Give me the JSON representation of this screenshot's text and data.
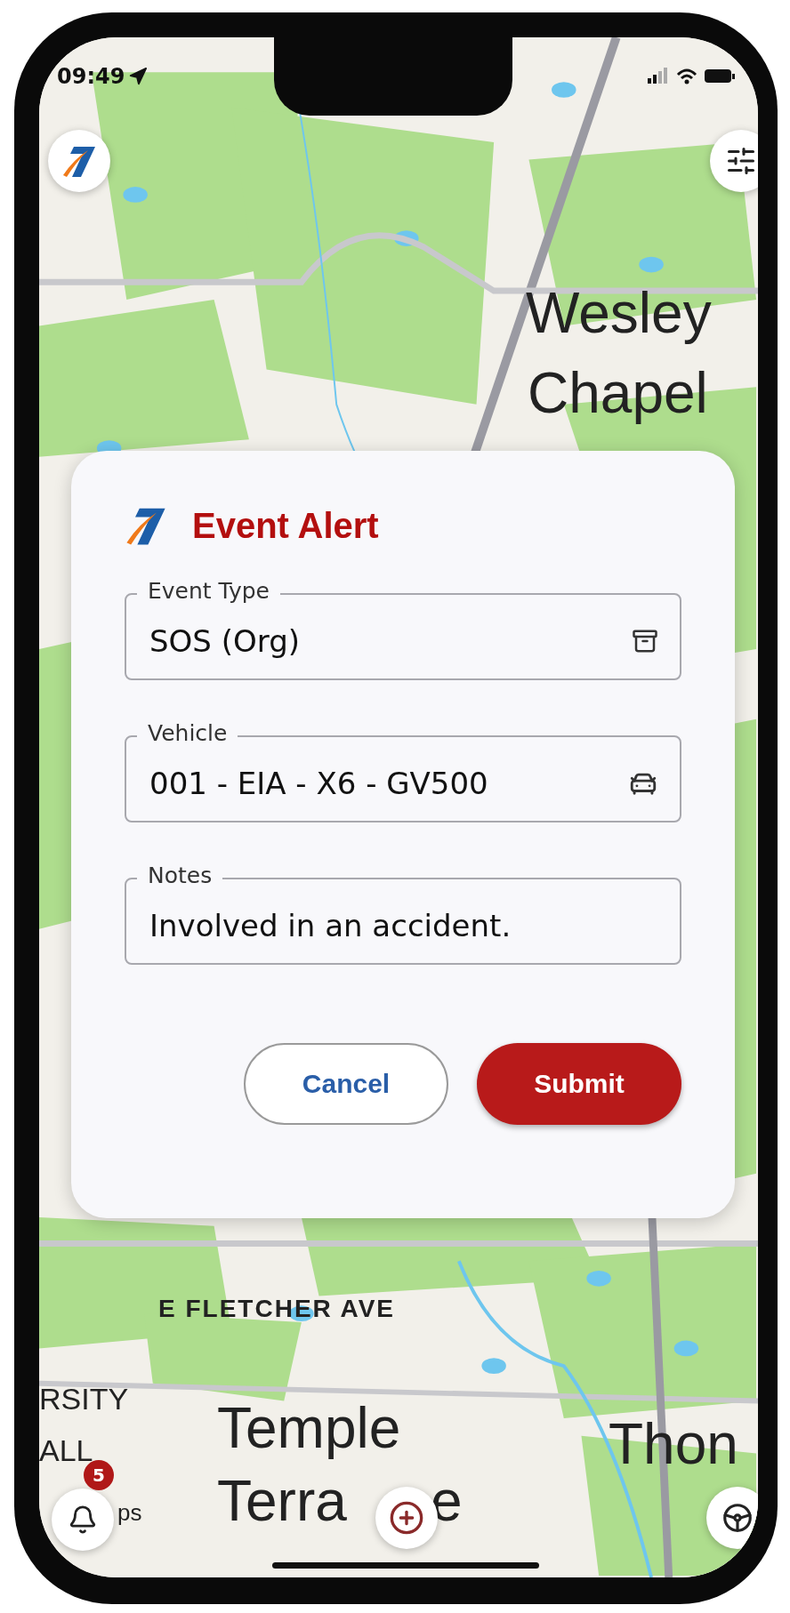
{
  "status_bar": {
    "time": "09:49"
  },
  "map": {
    "labels": [
      {
        "text": "Wesley",
        "kind": "city"
      },
      {
        "text": "Chapel",
        "kind": "city"
      },
      {
        "text": "E FLETCHER AVE",
        "kind": "road"
      },
      {
        "text": "RSITY",
        "kind": "area"
      },
      {
        "text": "ALL",
        "kind": "area"
      },
      {
        "text": "Temple",
        "kind": "city"
      },
      {
        "text": "Terra",
        "kind": "city"
      },
      {
        "text": "e",
        "kind": "city"
      },
      {
        "text": "Thon",
        "kind": "city"
      },
      {
        "text": "ps",
        "kind": "small"
      }
    ]
  },
  "dialog": {
    "title": "Event Alert",
    "fields": [
      {
        "label": "Event Type",
        "value": "SOS (Org)",
        "kind": "select"
      },
      {
        "label": "Vehicle",
        "value": "001 - EIA - X6 - GV500",
        "kind": "vehicle"
      },
      {
        "label": "Notes",
        "value": "Involved in an accident.",
        "kind": "text"
      }
    ],
    "buttons": [
      {
        "label": "Cancel",
        "kind": "secondary"
      },
      {
        "label": "Submit",
        "kind": "primary"
      }
    ]
  },
  "notifications": {
    "count": "5"
  }
}
